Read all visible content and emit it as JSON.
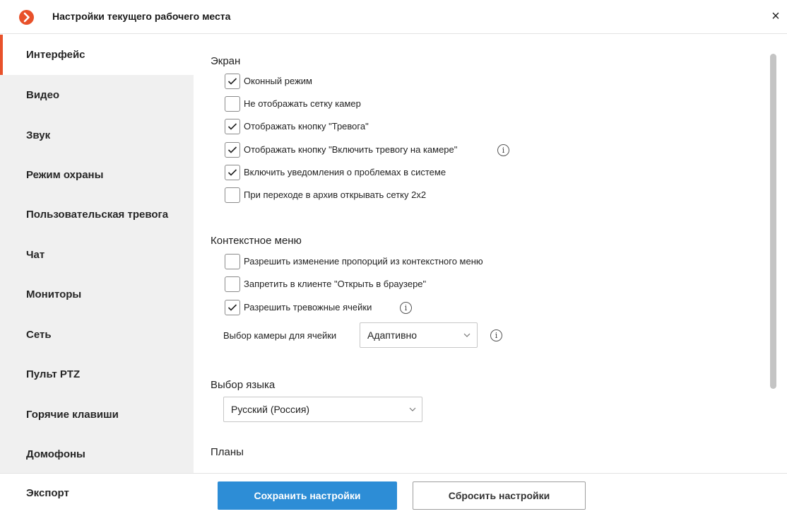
{
  "window": {
    "title": "Настройки текущего рабочего места",
    "close_label": "×"
  },
  "colors": {
    "accent": "#e8512a",
    "primary_button": "#2d8dd6",
    "sidebar_bg": "#f0f0f0"
  },
  "sidebar": {
    "items": [
      {
        "label": "Интерфейс",
        "active": true
      },
      {
        "label": "Видео",
        "active": false
      },
      {
        "label": "Звук",
        "active": false
      },
      {
        "label": "Режим охраны",
        "active": false
      },
      {
        "label": "Пользовательская тревога",
        "active": false
      },
      {
        "label": "Чат",
        "active": false
      },
      {
        "label": "Мониторы",
        "active": false
      },
      {
        "label": "Сеть",
        "active": false
      },
      {
        "label": "Пульт PTZ",
        "active": false
      },
      {
        "label": "Горячие клавиши",
        "active": false
      },
      {
        "label": "Домофоны",
        "active": false
      }
    ],
    "export_label": "Экспорт"
  },
  "screen": {
    "title": "Экран",
    "options": [
      {
        "label": "Оконный режим",
        "checked": true
      },
      {
        "label": "Не отображать сетку камер",
        "checked": false
      },
      {
        "label": "Отображать кнопку \"Тревога\"",
        "checked": true
      },
      {
        "label": "Отображать кнопку \"Включить тревогу на камере\"",
        "checked": true,
        "info": true
      },
      {
        "label": "Включить уведомления о проблемах в системе",
        "checked": true
      },
      {
        "label": "При переходе в архив открывать сетку 2x2",
        "checked": false
      }
    ]
  },
  "context_menu": {
    "title": "Контекстное меню",
    "options": [
      {
        "label": "Разрешить изменение пропорций из контекстного меню",
        "checked": false
      },
      {
        "label": "Запретить в клиенте \"Открыть в браузере\"",
        "checked": false
      },
      {
        "label": "Разрешить тревожные ячейки",
        "checked": true,
        "info": true
      }
    ],
    "camera_select_label": "Выбор камеры для ячейки",
    "camera_select_value": "Адаптивно"
  },
  "language": {
    "title": "Выбор языка",
    "value": "Русский (Россия)"
  },
  "plans": {
    "title": "Планы"
  },
  "footer": {
    "save_label": "Сохранить настройки",
    "reset_label": "Сбросить настройки"
  },
  "icons": {
    "logo": "app-logo-icon",
    "info": "info-icon",
    "chevron": "chevron-down-icon",
    "check": "checkmark-icon"
  }
}
